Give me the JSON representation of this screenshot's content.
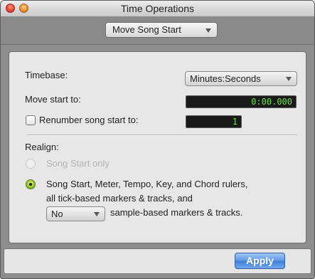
{
  "window": {
    "title": "Time Operations",
    "colors": {
      "lcd_text": "#67e23c",
      "apply_button": "#4a88e0",
      "radio_selected": "#98c630"
    }
  },
  "operation": {
    "selected": "Move Song Start"
  },
  "form": {
    "timebase_label": "Timebase:",
    "timebase_value": "Minutes:Seconds",
    "move_start_label": "Move start to:",
    "move_start_value": "0:00.000",
    "renumber_label": "Renumber song start to:",
    "renumber_checked": false,
    "renumber_value": "1"
  },
  "realign": {
    "label": "Realign:",
    "option_song_start_only": "Song Start only",
    "option_rulers_line1": "Song Start, Meter, Tempo, Key, and Chord rulers,",
    "option_rulers_line2": "all tick-based markers & tracks, and",
    "sample_based_select": "No",
    "sample_based_suffix": "sample-based markers & tracks."
  },
  "footer": {
    "apply_label": "Apply"
  }
}
